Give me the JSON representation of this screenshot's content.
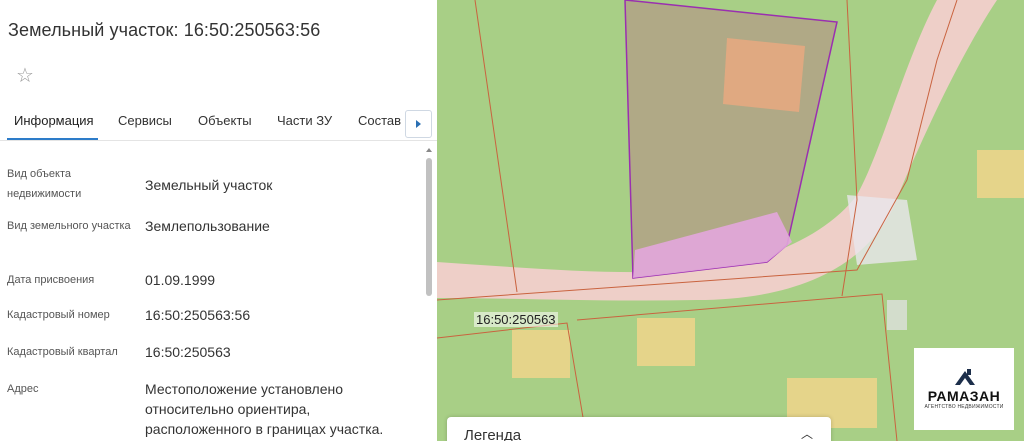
{
  "panel": {
    "title": "Земельный участок: 16:50:250563:56",
    "favorite_icon": "star-icon"
  },
  "tabs": [
    {
      "label": "Информация",
      "active": true
    },
    {
      "label": "Сервисы",
      "active": false
    },
    {
      "label": "Объекты",
      "active": false
    },
    {
      "label": "Части ЗУ",
      "active": false
    },
    {
      "label": "Состав",
      "active": false
    }
  ],
  "tabs_next_icon": "chevron-right-icon",
  "rows": [
    {
      "label": "Вид объекта недвижимости",
      "value": "Земельный участок"
    },
    {
      "label": "Вид земельного участка",
      "value": "Землепользование"
    },
    {
      "label": "Дата присвоения",
      "value": "01.09.1999"
    },
    {
      "label": "Кадастровый номер",
      "value": "16:50:250563:56"
    },
    {
      "label": "Кадастровый квартал",
      "value": "16:50:250563"
    },
    {
      "label": "Адрес",
      "value": "Местоположение установлено относительно ориентира, расположенного в границах участка."
    }
  ],
  "map": {
    "parcel_label": "16:50:250563",
    "legend_title": "Легенда",
    "legend_toggle_icon": "chevron-up-icon",
    "colors": {
      "grass": "#a8cf86",
      "road": "#eecfc8",
      "selected_parcel": "#b0a986",
      "highlight": "#e3a6dd",
      "boundary": "#9a2fb0",
      "building": "#e8d48a"
    }
  },
  "logo": {
    "name": "РАМАЗАН",
    "subtitle": "АГЕНТСТВО НЕДВИЖИМОСТИ"
  }
}
